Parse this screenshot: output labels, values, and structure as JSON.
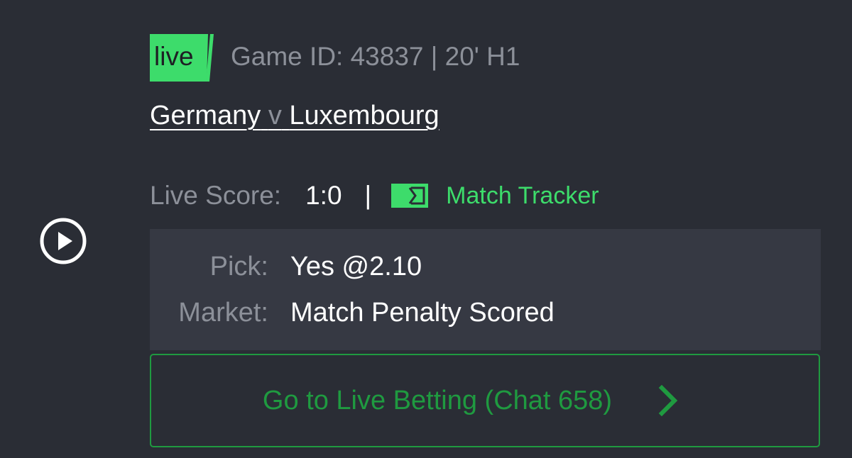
{
  "header": {
    "live_badge": "live",
    "game_info": "Game ID: 43837 | 20' H1"
  },
  "match": {
    "home_team": "Germany",
    "separator": "v",
    "away_team": "Luxembourg"
  },
  "score": {
    "label": "Live Score:",
    "value": "1:0",
    "separator": "|",
    "tracker_icon": "match-tracker-icon",
    "tracker_label": "Match Tracker"
  },
  "pick_card": {
    "pick_label": "Pick:",
    "pick_value": "Yes @2.10",
    "market_label": "Market:",
    "market_value": "Match Penalty Scored"
  },
  "cta": {
    "label": "Go to Live Betting (Chat 658)",
    "icon": "chevron-right-icon"
  },
  "icons": {
    "play": "play-icon"
  },
  "colors": {
    "background": "#2a2d35",
    "card": "#363943",
    "accent_green": "#3ddc6b",
    "button_green": "#1f9a40",
    "muted_text": "#8c9099",
    "text": "#ffffff"
  }
}
